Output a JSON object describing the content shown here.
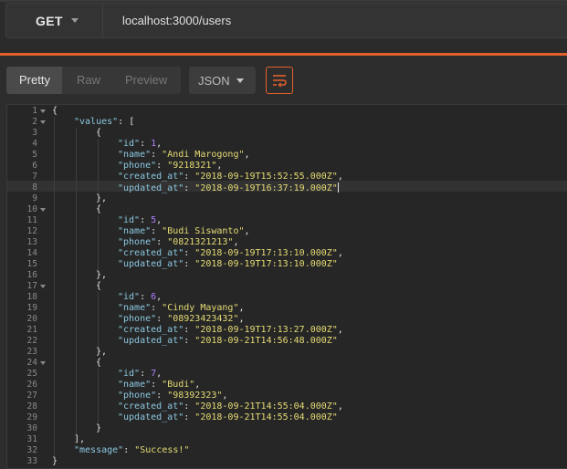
{
  "request": {
    "method": "GET",
    "url": "localhost:3000/users"
  },
  "response_toolbar": {
    "views": [
      "Pretty",
      "Raw",
      "Preview"
    ],
    "active_view": "Pretty",
    "format": "JSON",
    "wrap_icon": "wrap-lines-icon"
  },
  "colors": {
    "accent": "#e2612b",
    "key": "#8bc8e0",
    "string": "#e6db74",
    "number": "#ae81ff"
  },
  "response_body": {
    "lines": [
      {
        "n": "1",
        "fold": true,
        "indent": 0,
        "tokens": [
          [
            "pun",
            "{"
          ]
        ]
      },
      {
        "n": "2",
        "fold": true,
        "indent": 1,
        "tokens": [
          [
            "key",
            "\"values\""
          ],
          [
            "pun",
            ": ["
          ]
        ]
      },
      {
        "n": "3",
        "fold": false,
        "indent": 2,
        "tokens": [
          [
            "pun",
            "{"
          ]
        ]
      },
      {
        "n": "4",
        "fold": false,
        "indent": 3,
        "tokens": [
          [
            "key",
            "\"id\""
          ],
          [
            "pun",
            ": "
          ],
          [
            "num",
            "1"
          ],
          [
            "pun",
            ","
          ]
        ]
      },
      {
        "n": "5",
        "fold": false,
        "indent": 3,
        "tokens": [
          [
            "key",
            "\"name\""
          ],
          [
            "pun",
            ": "
          ],
          [
            "str",
            "\"Andi Marogong\""
          ],
          [
            "pun",
            ","
          ]
        ]
      },
      {
        "n": "6",
        "fold": false,
        "indent": 3,
        "tokens": [
          [
            "key",
            "\"phone\""
          ],
          [
            "pun",
            ": "
          ],
          [
            "str",
            "\"9218321\""
          ],
          [
            "pun",
            ","
          ]
        ]
      },
      {
        "n": "7",
        "fold": false,
        "indent": 3,
        "tokens": [
          [
            "key",
            "\"created_at\""
          ],
          [
            "pun",
            ": "
          ],
          [
            "str",
            "\"2018-09-19T15:52:55.000Z\""
          ],
          [
            "pun",
            ","
          ]
        ]
      },
      {
        "n": "8",
        "fold": false,
        "indent": 3,
        "cursor": true,
        "tokens": [
          [
            "key",
            "\"updated_at\""
          ],
          [
            "pun",
            ": "
          ],
          [
            "str",
            "\"2018-09-19T16:37:19.000Z\""
          ]
        ]
      },
      {
        "n": "9",
        "fold": false,
        "indent": 2,
        "tokens": [
          [
            "pun",
            "},"
          ]
        ]
      },
      {
        "n": "10",
        "fold": true,
        "indent": 2,
        "tokens": [
          [
            "pun",
            "{"
          ]
        ]
      },
      {
        "n": "11",
        "fold": false,
        "indent": 3,
        "tokens": [
          [
            "key",
            "\"id\""
          ],
          [
            "pun",
            ": "
          ],
          [
            "num",
            "5"
          ],
          [
            "pun",
            ","
          ]
        ]
      },
      {
        "n": "12",
        "fold": false,
        "indent": 3,
        "tokens": [
          [
            "key",
            "\"name\""
          ],
          [
            "pun",
            ": "
          ],
          [
            "str",
            "\"Budi Siswanto\""
          ],
          [
            "pun",
            ","
          ]
        ]
      },
      {
        "n": "13",
        "fold": false,
        "indent": 3,
        "tokens": [
          [
            "key",
            "\"phone\""
          ],
          [
            "pun",
            ": "
          ],
          [
            "str",
            "\"0821321213\""
          ],
          [
            "pun",
            ","
          ]
        ]
      },
      {
        "n": "14",
        "fold": false,
        "indent": 3,
        "tokens": [
          [
            "key",
            "\"created_at\""
          ],
          [
            "pun",
            ": "
          ],
          [
            "str",
            "\"2018-09-19T17:13:10.000Z\""
          ],
          [
            "pun",
            ","
          ]
        ]
      },
      {
        "n": "15",
        "fold": false,
        "indent": 3,
        "tokens": [
          [
            "key",
            "\"updated_at\""
          ],
          [
            "pun",
            ": "
          ],
          [
            "str",
            "\"2018-09-19T17:13:10.000Z\""
          ]
        ]
      },
      {
        "n": "16",
        "fold": false,
        "indent": 2,
        "tokens": [
          [
            "pun",
            "},"
          ]
        ]
      },
      {
        "n": "17",
        "fold": true,
        "indent": 2,
        "tokens": [
          [
            "pun",
            "{"
          ]
        ]
      },
      {
        "n": "18",
        "fold": false,
        "indent": 3,
        "tokens": [
          [
            "key",
            "\"id\""
          ],
          [
            "pun",
            ": "
          ],
          [
            "num",
            "6"
          ],
          [
            "pun",
            ","
          ]
        ]
      },
      {
        "n": "19",
        "fold": false,
        "indent": 3,
        "tokens": [
          [
            "key",
            "\"name\""
          ],
          [
            "pun",
            ": "
          ],
          [
            "str",
            "\"Cindy Mayang\""
          ],
          [
            "pun",
            ","
          ]
        ]
      },
      {
        "n": "20",
        "fold": false,
        "indent": 3,
        "tokens": [
          [
            "key",
            "\"phone\""
          ],
          [
            "pun",
            ": "
          ],
          [
            "str",
            "\"08923423432\""
          ],
          [
            "pun",
            ","
          ]
        ]
      },
      {
        "n": "21",
        "fold": false,
        "indent": 3,
        "tokens": [
          [
            "key",
            "\"created_at\""
          ],
          [
            "pun",
            ": "
          ],
          [
            "str",
            "\"2018-09-19T17:13:27.000Z\""
          ],
          [
            "pun",
            ","
          ]
        ]
      },
      {
        "n": "22",
        "fold": false,
        "indent": 3,
        "tokens": [
          [
            "key",
            "\"updated_at\""
          ],
          [
            "pun",
            ": "
          ],
          [
            "str",
            "\"2018-09-21T14:56:48.000Z\""
          ]
        ]
      },
      {
        "n": "23",
        "fold": false,
        "indent": 2,
        "tokens": [
          [
            "pun",
            "},"
          ]
        ]
      },
      {
        "n": "24",
        "fold": true,
        "indent": 2,
        "tokens": [
          [
            "pun",
            "{"
          ]
        ]
      },
      {
        "n": "25",
        "fold": false,
        "indent": 3,
        "tokens": [
          [
            "key",
            "\"id\""
          ],
          [
            "pun",
            ": "
          ],
          [
            "num",
            "7"
          ],
          [
            "pun",
            ","
          ]
        ]
      },
      {
        "n": "26",
        "fold": false,
        "indent": 3,
        "tokens": [
          [
            "key",
            "\"name\""
          ],
          [
            "pun",
            ": "
          ],
          [
            "str",
            "\"Budi\""
          ],
          [
            "pun",
            ","
          ]
        ]
      },
      {
        "n": "27",
        "fold": false,
        "indent": 3,
        "tokens": [
          [
            "key",
            "\"phone\""
          ],
          [
            "pun",
            ": "
          ],
          [
            "str",
            "\"98392323\""
          ],
          [
            "pun",
            ","
          ]
        ]
      },
      {
        "n": "28",
        "fold": false,
        "indent": 3,
        "tokens": [
          [
            "key",
            "\"created_at\""
          ],
          [
            "pun",
            ": "
          ],
          [
            "str",
            "\"2018-09-21T14:55:04.000Z\""
          ],
          [
            "pun",
            ","
          ]
        ]
      },
      {
        "n": "29",
        "fold": false,
        "indent": 3,
        "tokens": [
          [
            "key",
            "\"updated_at\""
          ],
          [
            "pun",
            ": "
          ],
          [
            "str",
            "\"2018-09-21T14:55:04.000Z\""
          ]
        ]
      },
      {
        "n": "30",
        "fold": false,
        "indent": 2,
        "tokens": [
          [
            "pun",
            "}"
          ]
        ]
      },
      {
        "n": "31",
        "fold": false,
        "indent": 1,
        "tokens": [
          [
            "pun",
            "],"
          ]
        ]
      },
      {
        "n": "32",
        "fold": false,
        "indent": 1,
        "tokens": [
          [
            "key",
            "\"message\""
          ],
          [
            "pun",
            ": "
          ],
          [
            "str",
            "\"Success!\""
          ]
        ]
      },
      {
        "n": "33",
        "fold": false,
        "indent": 0,
        "tokens": [
          [
            "pun",
            "}"
          ]
        ]
      }
    ]
  }
}
